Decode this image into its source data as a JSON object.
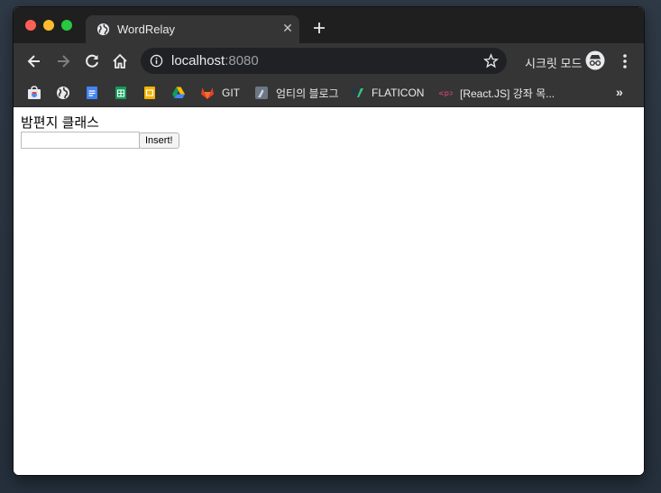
{
  "tab": {
    "title": "WordRelay",
    "close_glyph": "✕"
  },
  "omnibox": {
    "host": "localhost",
    "port": ":8080"
  },
  "incognito": {
    "label": "시크릿 모드"
  },
  "bookmarks": [
    {
      "icon": "chrome-webstore-icon",
      "label": ""
    },
    {
      "icon": "globe-icon",
      "label": ""
    },
    {
      "icon": "google-docs-icon",
      "label": ""
    },
    {
      "icon": "google-sheets-icon",
      "label": ""
    },
    {
      "icon": "google-slides-icon",
      "label": ""
    },
    {
      "icon": "google-drive-icon",
      "label": ""
    },
    {
      "icon": "gitlab-icon",
      "label": "GIT"
    },
    {
      "icon": "blog-icon",
      "label": "엄티의 블로그"
    },
    {
      "icon": "flaticon-icon",
      "label": "FLATICON"
    },
    {
      "icon": "react-course-icon",
      "label": "[React.JS] 강좌 목..."
    }
  ],
  "bookmarks_overflow": "»",
  "page": {
    "heading": "밤편지 클래스",
    "input_value": "",
    "button_label": "Insert!"
  },
  "colors": {
    "titlebar": "#1f1f1f",
    "toolbar": "#353535",
    "omnibox": "#202124",
    "close": "#fe5f57",
    "minimize": "#febc2e",
    "maximize": "#28c840"
  }
}
